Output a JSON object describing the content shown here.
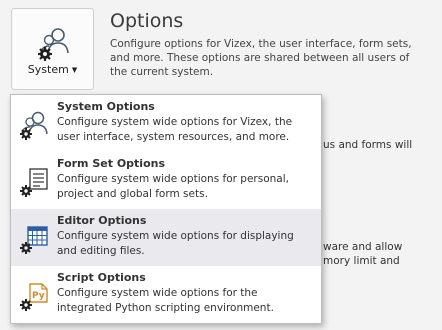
{
  "header": {
    "button_label": "System",
    "title": "Options",
    "description": "Configure options for Vizex, the user interface, form sets, and more. These options are shared between all users of the current system."
  },
  "background_fragments": [
    "us and forms will",
    "ware and allow",
    "mory limit and"
  ],
  "menu": {
    "items": [
      {
        "title": "System Options",
        "description": "Configure system wide options for Vizex, the user interface, system resources, and more.",
        "icon": "users-gear-icon"
      },
      {
        "title": "Form Set Options",
        "description": "Configure system wide options for personal, project and global form sets.",
        "icon": "form-gear-icon"
      },
      {
        "title": "Editor Options",
        "description": "Configure system wide options for displaying and editing files.",
        "icon": "grid-gear-icon",
        "highlighted": true
      },
      {
        "title": "Script Options",
        "description": "Configure system wide options for the integrated Python scripting environment.",
        "icon": "python-gear-icon"
      }
    ]
  },
  "colors": {
    "menu_highlight": "#e9e9ee",
    "background": "#f3f3f3",
    "python_orange": "#d58a2a",
    "grid_blue": "#2c5fa3"
  }
}
